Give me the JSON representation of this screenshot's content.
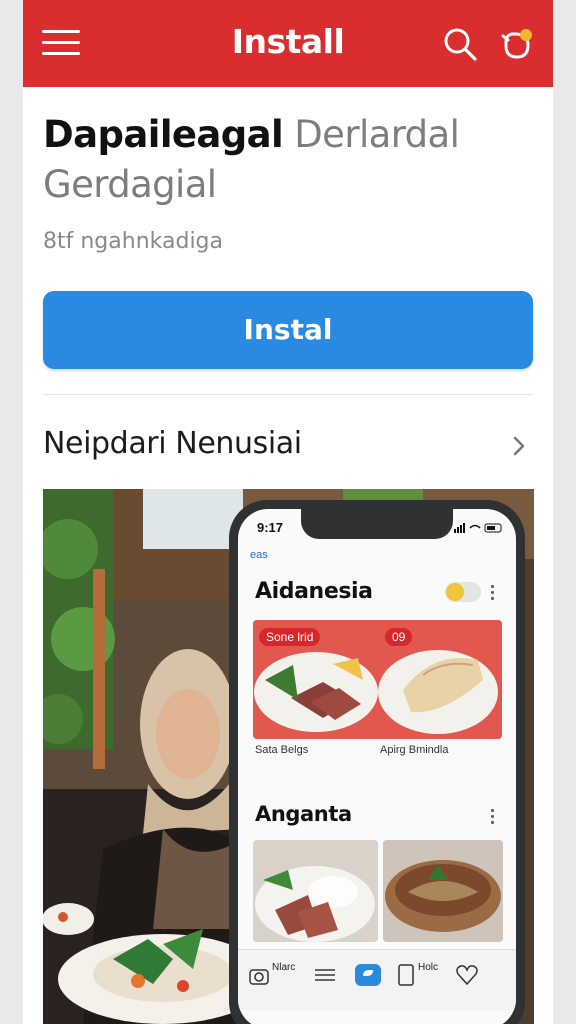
{
  "header": {
    "title": "Install",
    "menu_icon": "hamburger-menu-icon",
    "search_icon": "search-icon",
    "notification_icon": "bell-badge-icon",
    "color": "#d92d2f"
  },
  "app": {
    "title_bold": "Dapaileagal",
    "title_light": "Derlardal Gerdagial",
    "subtitle": "8tf ngahnkadiga"
  },
  "install_button": {
    "label": "Instal",
    "color": "#2a8ae2"
  },
  "section": {
    "label": "Neipdari Nenusiai",
    "chevron_icon": "chevron-right-icon"
  },
  "phone": {
    "time": "9:17",
    "back_link": "eas",
    "app_title": "Aidanesia",
    "card_badges": [
      "Sone lrid",
      "09"
    ],
    "card_captions": [
      "Sata Belgs",
      "Apirg Bmindla"
    ],
    "section_title": "Anganta",
    "tabs": [
      "Nlarc",
      "Holc"
    ],
    "tab_icons": [
      "camera-icon",
      "list-icon",
      "chat-icon",
      "phone-icon",
      "heart-icon"
    ]
  }
}
